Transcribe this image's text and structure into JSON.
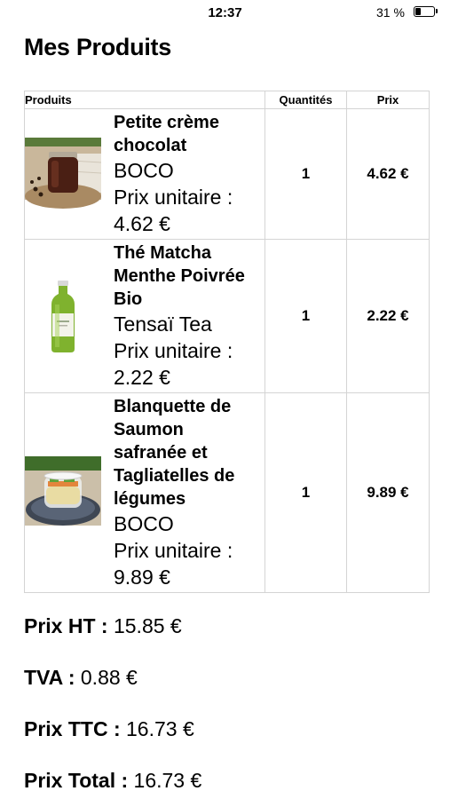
{
  "status": {
    "time": "12:37",
    "battery": "31 %",
    "battery_level": 0.31
  },
  "page": {
    "title": "Mes Produits"
  },
  "table": {
    "headers": {
      "product": "Produits",
      "quantity": "Quantités",
      "price": "Prix"
    },
    "rows": [
      {
        "name": "Petite crème chocolat",
        "brand": "BOCO",
        "unit_label": "Prix unitaire :",
        "unit_price": "4.62 €",
        "quantity": "1",
        "price": "4.62 €",
        "image": "chocolate-cream-jar"
      },
      {
        "name": "Thé Matcha Menthe Poivrée Bio",
        "brand": "Tensaï Tea",
        "unit_label": "Prix unitaire :",
        "unit_price": "2.22 €",
        "quantity": "1",
        "price": "2.22 €",
        "image": "matcha-tea-bottle"
      },
      {
        "name": "Blanquette de Saumon safranée et Tagliatelles de légumes",
        "brand": "BOCO",
        "unit_label": "Prix unitaire :",
        "unit_price": "9.89 €",
        "quantity": "1",
        "price": "9.89 €",
        "image": "salmon-blanquette-jar"
      }
    ]
  },
  "summary": {
    "ht_label": "Prix HT :",
    "ht_value": "15.85 €",
    "tva_label": "TVA :",
    "tva_value": "0.88 €",
    "ttc_label": "Prix TTC :",
    "ttc_value": "16.73 €",
    "total_label": "Prix Total :",
    "total_value": "16.73 €"
  }
}
